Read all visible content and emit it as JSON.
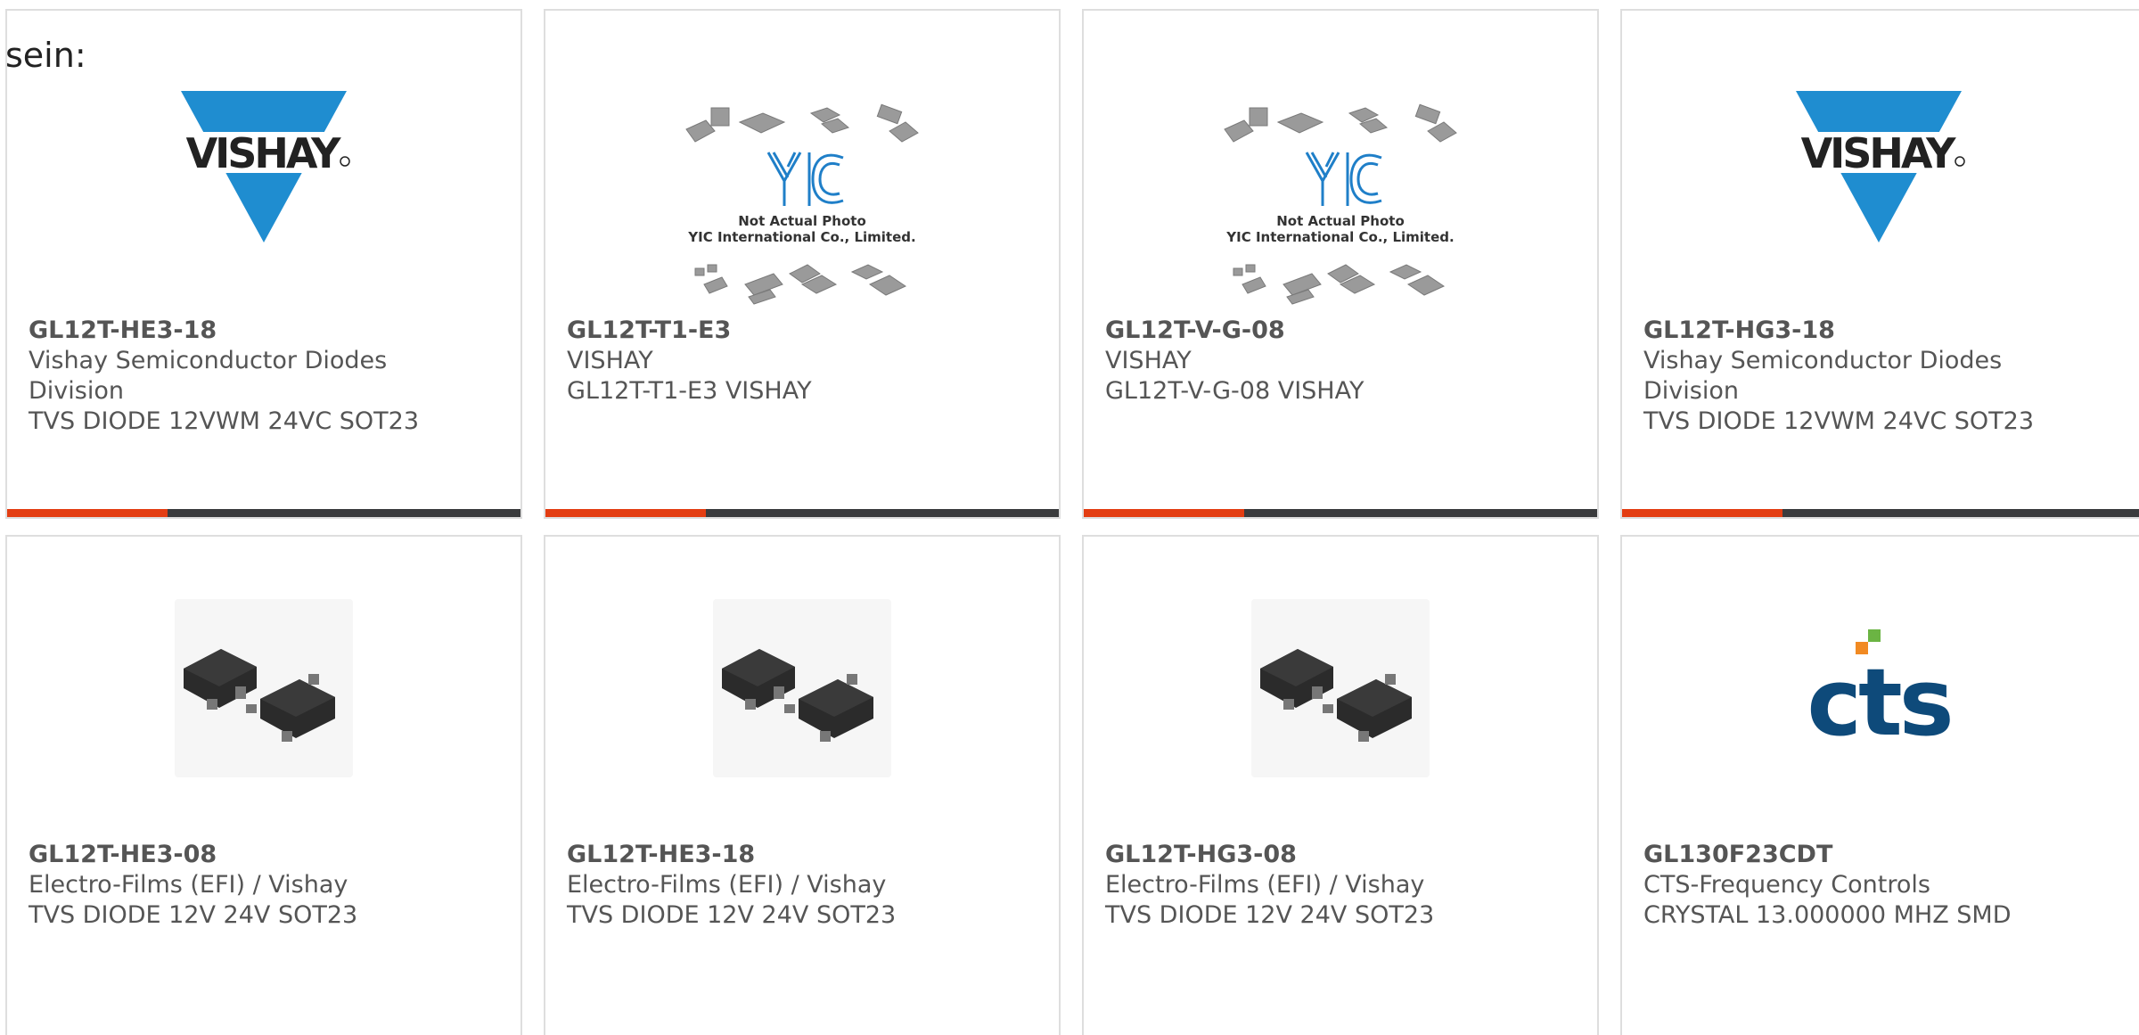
{
  "intro": {
    "text": "sein:"
  },
  "colors": {
    "accent": "#e33d12",
    "bar": "#3a3b3d",
    "vishay_blue": "#1f8dd0",
    "cts_navy": "#0e4a7a",
    "cts_green": "#6bb443",
    "cts_orange": "#f18a22"
  },
  "cards": [
    {
      "part": "GL12T-HE3-18",
      "lines": [
        "Vishay Semiconductor Diodes",
        "Division",
        "TVS DIODE 12VWM 24VC SOT23"
      ],
      "image": "vishay-logo",
      "brand_text": "VISHAY"
    },
    {
      "part": "GL12T-T1-E3",
      "lines": [
        "VISHAY",
        "GL12T-T1-E3 VISHAY"
      ],
      "image": "yic-placeholder",
      "brand_text": "YIC",
      "photo_note_1": "Not Actual Photo",
      "photo_note_2": "YIC International Co., Limited."
    },
    {
      "part": "GL12T-V-G-08",
      "lines": [
        "VISHAY",
        "GL12T-V-G-08 VISHAY"
      ],
      "image": "yic-placeholder",
      "brand_text": "YIC",
      "photo_note_1": "Not Actual Photo",
      "photo_note_2": "YIC International Co., Limited."
    },
    {
      "part": "GL12T-HG3-18",
      "lines": [
        "Vishay Semiconductor Diodes",
        "Division",
        "TVS DIODE 12VWM 24VC SOT23"
      ],
      "image": "vishay-logo",
      "brand_text": "VISHAY"
    },
    {
      "part": "GL12T-HE3-08",
      "lines": [
        "Electro-Films (EFI) / Vishay",
        "TVS DIODE 12V 24V SOT23"
      ],
      "image": "sot23-package"
    },
    {
      "part": "GL12T-HE3-18",
      "lines": [
        "Electro-Films (EFI) / Vishay",
        "TVS DIODE 12V 24V SOT23"
      ],
      "image": "sot23-package"
    },
    {
      "part": "GL12T-HG3-08",
      "lines": [
        "Electro-Films (EFI) / Vishay",
        "TVS DIODE 12V 24V SOT23"
      ],
      "image": "sot23-package"
    },
    {
      "part": "GL130F23CDT",
      "lines": [
        "CTS-Frequency Controls",
        "CRYSTAL 13.000000 MHZ SMD"
      ],
      "image": "cts-logo",
      "brand_text": "CTS"
    }
  ]
}
